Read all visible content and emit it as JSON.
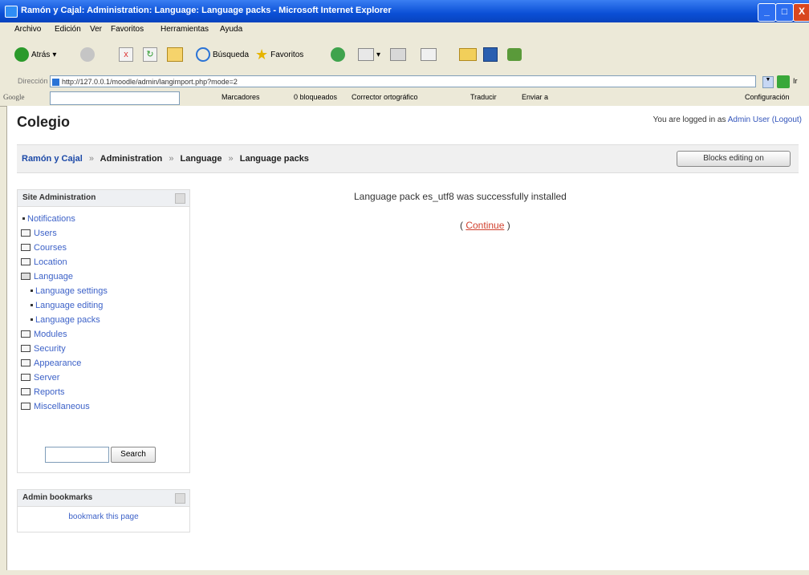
{
  "window": {
    "title": "Ramón y Cajal: Administration: Language: Language packs - Microsoft Internet Explorer",
    "min_glyph": "_",
    "max_glyph": "□",
    "close_glyph": "X"
  },
  "menubar": [
    "Archivo",
    "Edición",
    "Ver",
    "Favoritos",
    "Herramientas",
    "Ayuda"
  ],
  "toolbar": {
    "back_label": "Atrás",
    "search_label": "Búsqueda",
    "favorites_label": "Favoritos"
  },
  "address": {
    "label": "Dirección",
    "url": "http://127.0.0.1/moodle/admin/langimport.php?mode=2",
    "go_label": "Ir"
  },
  "googlebar": {
    "logo": "Google",
    "bookmarks_label": "Marcadores",
    "blocked_label": "0 bloqueados",
    "spell_label": "Corrector ortográfico",
    "translate_label": "Traducir",
    "send_label": "Enviar a",
    "settings_label": "Configuración"
  },
  "site": {
    "title": "Colegio",
    "login_prefix": "You are logged in as",
    "user": "Admin User",
    "logout": "(Logout)"
  },
  "breadcrumb": {
    "home": "Ramón y Cajal",
    "sep": "»",
    "items": [
      "Administration",
      "Language",
      "Language packs"
    ]
  },
  "blocks_button": "Blocks editing on",
  "admin_block": {
    "title": "Site Administration",
    "items": [
      {
        "label": "Notifications"
      },
      {
        "label": "Users"
      },
      {
        "label": "Courses"
      },
      {
        "label": "Location"
      },
      {
        "label": "Language"
      },
      {
        "label": "Language settings"
      },
      {
        "label": "Language editing"
      },
      {
        "label": "Language packs"
      },
      {
        "label": "Modules"
      },
      {
        "label": "Security"
      },
      {
        "label": "Appearance"
      },
      {
        "label": "Server"
      },
      {
        "label": "Reports"
      },
      {
        "label": "Miscellaneous"
      }
    ],
    "search_button": "Search"
  },
  "bookmarks_block": {
    "title": "Admin bookmarks",
    "link": "bookmark this page"
  },
  "main": {
    "message": "Language pack es_utf8 was successfully installed",
    "continue_open": "( ",
    "continue_label": "Continue",
    "continue_close": " )"
  },
  "colors": {
    "titlebar": "#0a4fd6",
    "link": "#3d62c8",
    "continue_link": "#d1412e"
  }
}
